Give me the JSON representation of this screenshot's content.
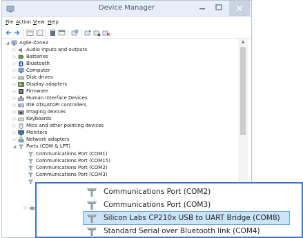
{
  "window": {
    "title": "Device Manager"
  },
  "menu": {
    "file": "File",
    "action": "Action",
    "view": "View",
    "help": "Help"
  },
  "tree": {
    "root": "Agile-Zone2",
    "categories": [
      {
        "label": "Audio inputs and outputs",
        "icon": "speaker-icon"
      },
      {
        "label": "Batteries",
        "icon": "battery-icon"
      },
      {
        "label": "Bluetooth",
        "icon": "bluetooth-icon"
      },
      {
        "label": "Computer",
        "icon": "computer-icon"
      },
      {
        "label": "Disk drives",
        "icon": "disk-drive-icon"
      },
      {
        "label": "Display adapters",
        "icon": "display-adapter-icon"
      },
      {
        "label": "Firmware",
        "icon": "firmware-icon"
      },
      {
        "label": "Human Interface Devices",
        "icon": "hid-icon"
      },
      {
        "label": "IDE ATA/ATAPI controllers",
        "icon": "ide-controller-icon"
      },
      {
        "label": "Imaging devices",
        "icon": "camera-icon"
      },
      {
        "label": "Keyboards",
        "icon": "keyboard-icon"
      },
      {
        "label": "Mice and other pointing devices",
        "icon": "mouse-icon"
      },
      {
        "label": "Monitors",
        "icon": "monitor-icon"
      },
      {
        "label": "Network adapters",
        "icon": "network-adapter-icon"
      }
    ],
    "ports": {
      "label": "Ports (COM & LPT)",
      "children": [
        "Communications Port (COM1)",
        "Communications Port (COM15)",
        "Communications Port (COM2)",
        "Communications Port (COM3)"
      ]
    }
  },
  "zoom": {
    "items": [
      {
        "label": "Communications Port (COM2)",
        "selected": false
      },
      {
        "label": "Communications Port (COM3)",
        "selected": false
      },
      {
        "label": "Silicon Labs CP210x USB to UART Bridge (COM8)",
        "selected": true
      },
      {
        "label": "Standard Serial over Bluetooth link (COM4)",
        "selected": false
      }
    ]
  },
  "colors": {
    "selection": "#cce4f7",
    "selection_border": "#6aa6dc",
    "zoom_border": "#3b73c8",
    "titlebar": "#e7eef8"
  }
}
